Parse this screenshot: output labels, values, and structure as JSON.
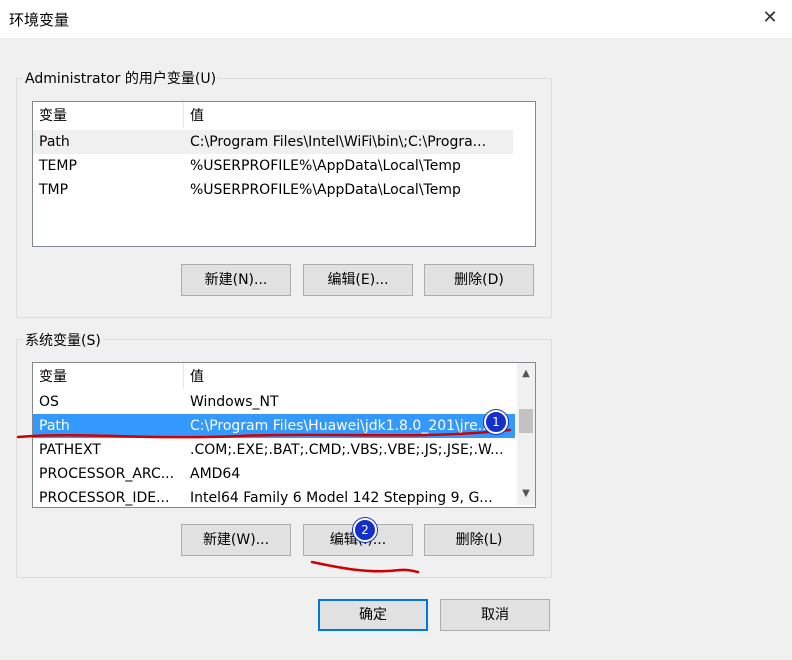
{
  "window": {
    "title": "环境变量",
    "close_label": "✕"
  },
  "user_vars": {
    "group_label": "Administrator 的用户变量(U)",
    "col_name": "变量",
    "col_value": "值",
    "rows": [
      {
        "name": "Path",
        "value": "C:\\Program Files\\Intel\\WiFi\\bin\\;C:\\Progra..."
      },
      {
        "name": "TEMP",
        "value": "%USERPROFILE%\\AppData\\Local\\Temp"
      },
      {
        "name": "TMP",
        "value": "%USERPROFILE%\\AppData\\Local\\Temp"
      }
    ],
    "new_label": "新建(N)...",
    "edit_label": "编辑(E)...",
    "delete_label": "删除(D)"
  },
  "system_vars": {
    "group_label": "系统变量(S)",
    "col_name": "变量",
    "col_value": "值",
    "rows": [
      {
        "name": "OS",
        "value": "Windows_NT"
      },
      {
        "name": "Path",
        "value": "C:\\Program Files\\Huawei\\jdk1.8.0_201\\jre..."
      },
      {
        "name": "PATHEXT",
        "value": ".COM;.EXE;.BAT;.CMD;.VBS;.VBE;.JS;.JSE;.W..."
      },
      {
        "name": "PROCESSOR_ARC...",
        "value": "AMD64"
      },
      {
        "name": "PROCESSOR_IDE...",
        "value": "Intel64 Family 6 Model 142 Stepping 9, G..."
      }
    ],
    "new_label": "新建(W)...",
    "edit_label": "编辑(I)...",
    "delete_label": "删除(L)"
  },
  "annotations": {
    "badge1": "1",
    "badge2": "2",
    "mark_color": "#d00000"
  },
  "footer": {
    "ok_label": "确定",
    "cancel_label": "取消"
  },
  "colors": {
    "selection": "#3399ff",
    "primary_border": "#0078d7"
  }
}
